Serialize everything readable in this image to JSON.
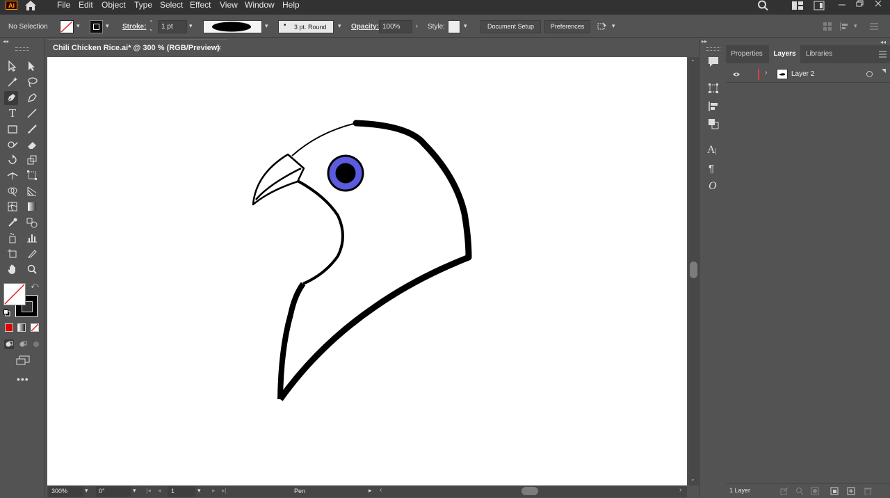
{
  "app": {
    "logo": "Ai"
  },
  "menu": [
    "File",
    "Edit",
    "Object",
    "Type",
    "Select",
    "Effect",
    "View",
    "Window",
    "Help"
  ],
  "control": {
    "selection": "No Selection",
    "stroke_label": "Stroke:",
    "stroke_weight": "1 pt",
    "brush": "3 pt. Round",
    "opacity_label": "Opacity:",
    "opacity": "100%",
    "style_label": "Style:",
    "document_setup": "Document Setup",
    "preferences": "Preferences"
  },
  "document": {
    "tab_title": "Chili Chicken Rice.ai* @ 300 % (RGB/Preview)",
    "close": "×"
  },
  "status": {
    "zoom": "300%",
    "rotation": "0°",
    "artboard": "1",
    "tool": "Pen"
  },
  "panel": {
    "tabs": [
      "Properties",
      "Layers",
      "Libraries"
    ],
    "active_tab": "Layers",
    "layer_name": "Layer 2",
    "layer_color": "#e63b3b",
    "footer_count": "1 Layer"
  },
  "colors": {
    "eye_iris": "#5b5be0",
    "fill_none_slash": "#e02020"
  },
  "icons": [
    "home-icon",
    "search-icon",
    "arrange-documents-icon",
    "minimize-icon",
    "restore-icon",
    "close-icon",
    "selection-tool-icon",
    "direct-selection-tool-icon",
    "pen-tool-icon",
    "type-tool-icon",
    "eye-icon",
    "hamburger-menu-icon"
  ]
}
